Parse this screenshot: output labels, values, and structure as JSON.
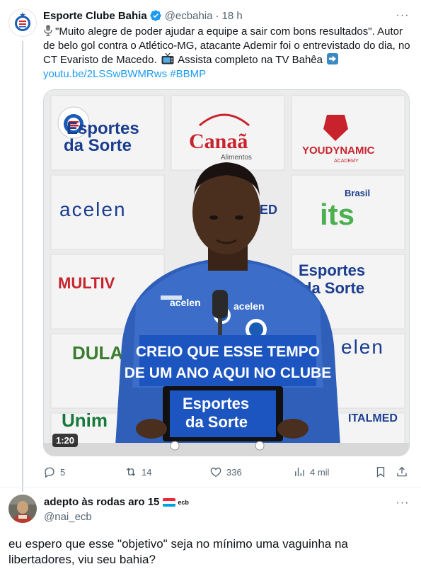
{
  "tweet": {
    "author_name": "Esporte Clube Bahia",
    "author_handle": "@ecbahia",
    "separator": "·",
    "time": "18 h",
    "more_label": "···",
    "text_line1": "\"Muito alegre de poder ajudar a equipe a sair com bons resultados\".",
    "text_line2": "Autor de belo gol contra o Atlético-MG, atacante Ademir foi o entrevistado do dia, no CT Evaristo de Macedo.",
    "text_line3": "Assista completo na TV Bahêa",
    "link": "youtu.be/2LSSwBWMRws",
    "hashtag": "#BBMP",
    "mic_icon": "studio-microphone-icon",
    "tv_icon": "television-icon",
    "arrow_icon": "right-arrow-icon"
  },
  "video": {
    "duration": "1:20",
    "caption_line1": "CREIO QUE ESSE TEMPO",
    "caption_line2": "DE UM ANO AQUI NO CLUBE",
    "sponsor_a1": "Esportes",
    "sponsor_a2": "da Sorte",
    "sponsor_b": "Canaã",
    "sponsor_b_sub": "Alimentos",
    "sponsor_c": "YOUDYNAMIC",
    "sponsor_c_sub": "ACADEMY",
    "sponsor_d": "acelen",
    "sponsor_e": "MED",
    "sponsor_f": "its",
    "sponsor_f_sub": "Brasil",
    "sponsor_g": "MULTIV",
    "sponsor_h": "DULA",
    "sponsor_i": "Unim",
    "sponsor_j": "ITALMED",
    "sponsor_k": "elen",
    "podium_1": "Esportes",
    "podium_2": "da Sorte",
    "shirt_text": "acelen"
  },
  "actions": {
    "replies": "5",
    "retweets": "14",
    "likes": "336",
    "views": "4 mil"
  },
  "reply": {
    "name": "adepto às rodas aro 15",
    "badge": "ecb",
    "handle": "@nai_ecb",
    "more_label": "···",
    "text": "eu espero que esse \"objetivo\" seja no mínimo uma vaguinha na libertadores, viu seu bahia?"
  },
  "colors": {
    "link": "#1d9bf0",
    "secondary": "#536471",
    "verified": "#1d9bf0",
    "bahia_blue": "#1a5cb5",
    "caption_bg": "#1c55c0"
  }
}
